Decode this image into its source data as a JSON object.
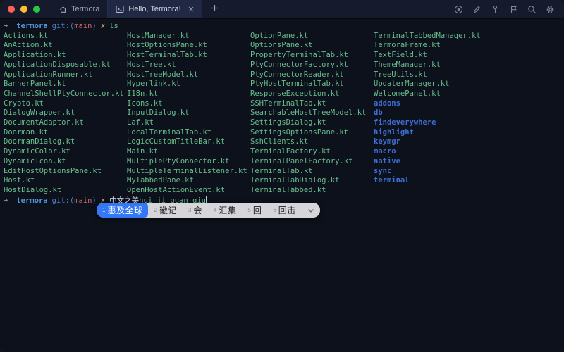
{
  "colors": {
    "background": "#0d111c",
    "titlebar": "#151a2c",
    "accent_blue": "#5398dd",
    "git_blue": "#4b7fc4",
    "branch_red": "#d16a6a",
    "mark_yellow": "#d8a04f",
    "file_green": "#67bd8b",
    "dir_blue": "#3e6fd6",
    "selection_blue": "#3478f6",
    "ime_bar": "#d6d6da"
  },
  "titlebar": {
    "window_controls": [
      "close",
      "minimize",
      "zoom"
    ],
    "tabs": [
      {
        "label": "Termora",
        "icon": "home-icon",
        "active": false
      },
      {
        "label": "Hello, Termora!",
        "icon": "terminal-icon",
        "active": true,
        "closable": true
      }
    ],
    "new_tab_icon": "plus-icon",
    "toolbar_icons": [
      "record-icon",
      "edit-icon",
      "key-icon",
      "flag-icon",
      "search-icon",
      "settings-icon"
    ]
  },
  "terminal": {
    "prompt1": {
      "arrow": "➜",
      "directory": "termora",
      "git_label": "git:(",
      "branch": "main",
      "git_close": ")",
      "status_mark": "✗",
      "command": "ls"
    },
    "listing": {
      "columns": [
        {
          "items": [
            {
              "label": "Actions.kt",
              "type": "file"
            },
            {
              "label": "AnAction.kt",
              "type": "file"
            },
            {
              "label": "Application.kt",
              "type": "file"
            },
            {
              "label": "ApplicationDisposable.kt",
              "type": "file"
            },
            {
              "label": "ApplicationRunner.kt",
              "type": "file"
            },
            {
              "label": "BannerPanel.kt",
              "type": "file"
            },
            {
              "label": "ChannelShellPtyConnector.kt",
              "type": "file"
            },
            {
              "label": "Crypto.kt",
              "type": "file"
            },
            {
              "label": "DialogWrapper.kt",
              "type": "file"
            },
            {
              "label": "DocumentAdaptor.kt",
              "type": "file"
            },
            {
              "label": "Doorman.kt",
              "type": "file"
            },
            {
              "label": "DoormanDialog.kt",
              "type": "file"
            },
            {
              "label": "DynamicColor.kt",
              "type": "file"
            },
            {
              "label": "DynamicIcon.kt",
              "type": "file"
            },
            {
              "label": "EditHostOptionsPane.kt",
              "type": "file"
            },
            {
              "label": "Host.kt",
              "type": "file"
            },
            {
              "label": "HostDialog.kt",
              "type": "file"
            }
          ]
        },
        {
          "items": [
            {
              "label": "HostManager.kt",
              "type": "file"
            },
            {
              "label": "HostOptionsPane.kt",
              "type": "file"
            },
            {
              "label": "HostTerminalTab.kt",
              "type": "file"
            },
            {
              "label": "HostTree.kt",
              "type": "file"
            },
            {
              "label": "HostTreeModel.kt",
              "type": "file"
            },
            {
              "label": "Hyperlink.kt",
              "type": "file"
            },
            {
              "label": "I18n.kt",
              "type": "file"
            },
            {
              "label": "Icons.kt",
              "type": "file"
            },
            {
              "label": "InputDialog.kt",
              "type": "file"
            },
            {
              "label": "Laf.kt",
              "type": "file"
            },
            {
              "label": "LocalTerminalTab.kt",
              "type": "file"
            },
            {
              "label": "LogicCustomTitleBar.kt",
              "type": "file"
            },
            {
              "label": "Main.kt",
              "type": "file"
            },
            {
              "label": "MultiplePtyConnector.kt",
              "type": "file"
            },
            {
              "label": "MultipleTerminalListener.kt",
              "type": "file"
            },
            {
              "label": "MyTabbedPane.kt",
              "type": "file"
            },
            {
              "label": "OpenHostActionEvent.kt",
              "type": "file"
            }
          ]
        },
        {
          "items": [
            {
              "label": "OptionPane.kt",
              "type": "file"
            },
            {
              "label": "OptionsPane.kt",
              "type": "file"
            },
            {
              "label": "PropertyTerminalTab.kt",
              "type": "file"
            },
            {
              "label": "PtyConnectorFactory.kt",
              "type": "file"
            },
            {
              "label": "PtyConnectorReader.kt",
              "type": "file"
            },
            {
              "label": "PtyHostTerminalTab.kt",
              "type": "file"
            },
            {
              "label": "ResponseException.kt",
              "type": "file"
            },
            {
              "label": "SSHTerminalTab.kt",
              "type": "file"
            },
            {
              "label": "SearchableHostTreeModel.kt",
              "type": "file"
            },
            {
              "label": "SettingsDialog.kt",
              "type": "file"
            },
            {
              "label": "SettingsOptionsPane.kt",
              "type": "file"
            },
            {
              "label": "SshClients.kt",
              "type": "file"
            },
            {
              "label": "TerminalFactory.kt",
              "type": "file"
            },
            {
              "label": "TerminalPanelFactory.kt",
              "type": "file"
            },
            {
              "label": "TerminalTab.kt",
              "type": "file"
            },
            {
              "label": "TerminalTabDialog.kt",
              "type": "file"
            },
            {
              "label": "TerminalTabbed.kt",
              "type": "file"
            }
          ]
        },
        {
          "items": [
            {
              "label": "TerminalTabbedManager.kt",
              "type": "file"
            },
            {
              "label": "TermoraFrame.kt",
              "type": "file"
            },
            {
              "label": "TextField.kt",
              "type": "file"
            },
            {
              "label": "ThemeManager.kt",
              "type": "file"
            },
            {
              "label": "TreeUtils.kt",
              "type": "file"
            },
            {
              "label": "UpdaterManager.kt",
              "type": "file"
            },
            {
              "label": "WelcomePanel.kt",
              "type": "file"
            },
            {
              "label": "addons",
              "type": "dir"
            },
            {
              "label": "db",
              "type": "dir"
            },
            {
              "label": "findeverywhere",
              "type": "dir"
            },
            {
              "label": "highlight",
              "type": "dir"
            },
            {
              "label": "keymgr",
              "type": "dir"
            },
            {
              "label": "macro",
              "type": "dir"
            },
            {
              "label": "native",
              "type": "dir"
            },
            {
              "label": "sync",
              "type": "dir"
            },
            {
              "label": "terminal",
              "type": "dir"
            }
          ]
        }
      ]
    },
    "prompt2": {
      "arrow": "➜",
      "directory": "termora",
      "git_label": "git:(",
      "branch": "main",
      "git_close": ")",
      "status_mark": "✗",
      "typed_text": "中文之美",
      "composition_text": "hui ji quan qiu"
    }
  },
  "ime": {
    "candidates": [
      {
        "index": "1",
        "text": "惠及全球",
        "selected": true
      },
      {
        "index": "2",
        "text": "徽记",
        "selected": false
      },
      {
        "index": "3",
        "text": "会",
        "selected": false
      },
      {
        "index": "4",
        "text": "汇集",
        "selected": false
      },
      {
        "index": "5",
        "text": "回",
        "selected": false
      },
      {
        "index": "6",
        "text": "回击",
        "selected": false
      }
    ],
    "more_icon": "chevron-down-icon"
  }
}
